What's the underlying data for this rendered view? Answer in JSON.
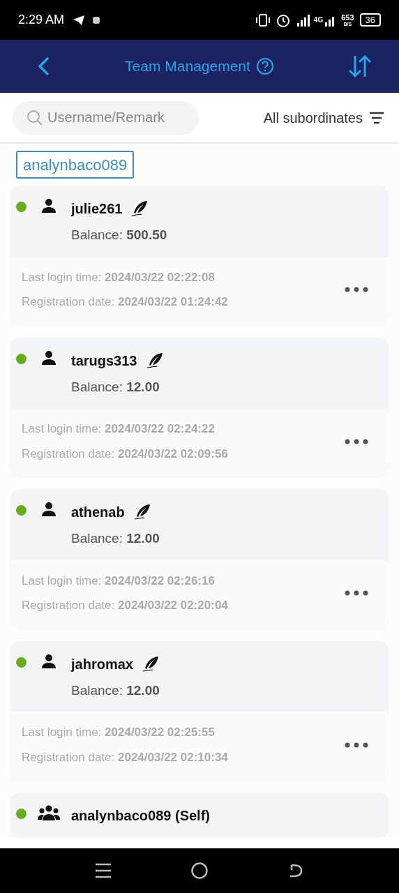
{
  "status_bar": {
    "time": "2:29 AM",
    "network": "4G",
    "speed": "653",
    "speed_unit": "B/S",
    "battery": "36"
  },
  "header": {
    "title": "Team Management"
  },
  "search": {
    "placeholder": "Username/Remark"
  },
  "filter": {
    "label": "All subordinates"
  },
  "breadcrumb": "analynbaco089",
  "members": [
    {
      "kind": "member",
      "online": true,
      "name": "julie261",
      "balance": "Balance: **500.50**",
      "last_login": "Last login time: **2024/03/22 02:22:08**",
      "registered": "Registration date: **2024/03/22 01:24:42**"
    },
    {
      "kind": "member",
      "online": true,
      "name": "tarugs313",
      "balance": "Balance: **12.00**",
      "last_login": "Last login time: **2024/03/22 02:24:22**",
      "registered": "Registration date: **2024/03/22 02:09:56**"
    },
    {
      "kind": "member",
      "online": true,
      "name": "athenab",
      "balance": "Balance: **12.00**",
      "last_login": "Last login time: **2024/03/22 02:26:16**",
      "registered": "Registration date: **2024/03/22 02:20:04**"
    },
    {
      "kind": "member",
      "online": true,
      "name": "jahromax",
      "balance": "Balance: **12.00**",
      "last_login": "Last login time: **2024/03/22 02:25:55**",
      "registered": "Registration date: **2024/03/22 02:10:34**"
    },
    {
      "kind": "self",
      "online": true,
      "name": "analynbaco089 (Self)"
    }
  ]
}
